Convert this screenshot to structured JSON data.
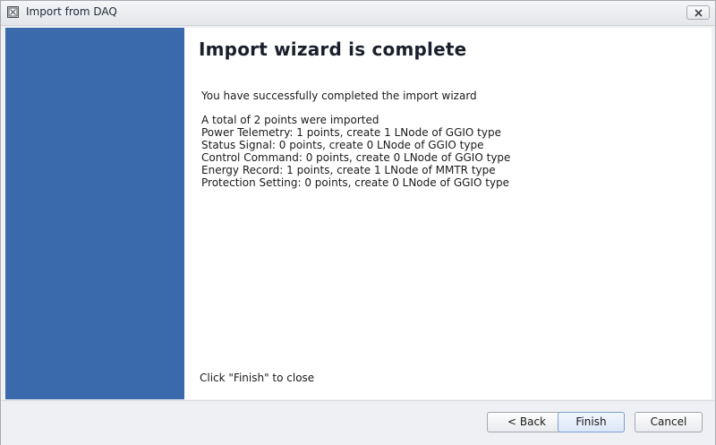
{
  "window": {
    "title": "Import from DAQ"
  },
  "content": {
    "heading": "Import wizard is complete",
    "success_message": "You have successfully completed the import wizard",
    "summary_lines": [
      "A total of 2 points were imported",
      "Power Telemetry: 1 points, create 1 LNode of GGIO type",
      "Status Signal: 0 points, create 0 LNode of GGIO type",
      "Control Command: 0 points, create 0 LNode of GGIO type",
      "Energy Record: 1 points, create 1 LNode of MMTR type",
      "Protection Setting: 0 points, create 0 LNode of GGIO type"
    ],
    "close_hint": "Click \"Finish\" to close"
  },
  "buttons": {
    "back_label": "< Back",
    "finish_label": "Finish",
    "cancel_label": "Cancel"
  },
  "icons": {
    "app": "app-window-icon",
    "close": "close-icon"
  },
  "colors": {
    "side_panel": "#3a6aac",
    "content_background": "#ffffff",
    "window_background": "#eef0f3"
  }
}
